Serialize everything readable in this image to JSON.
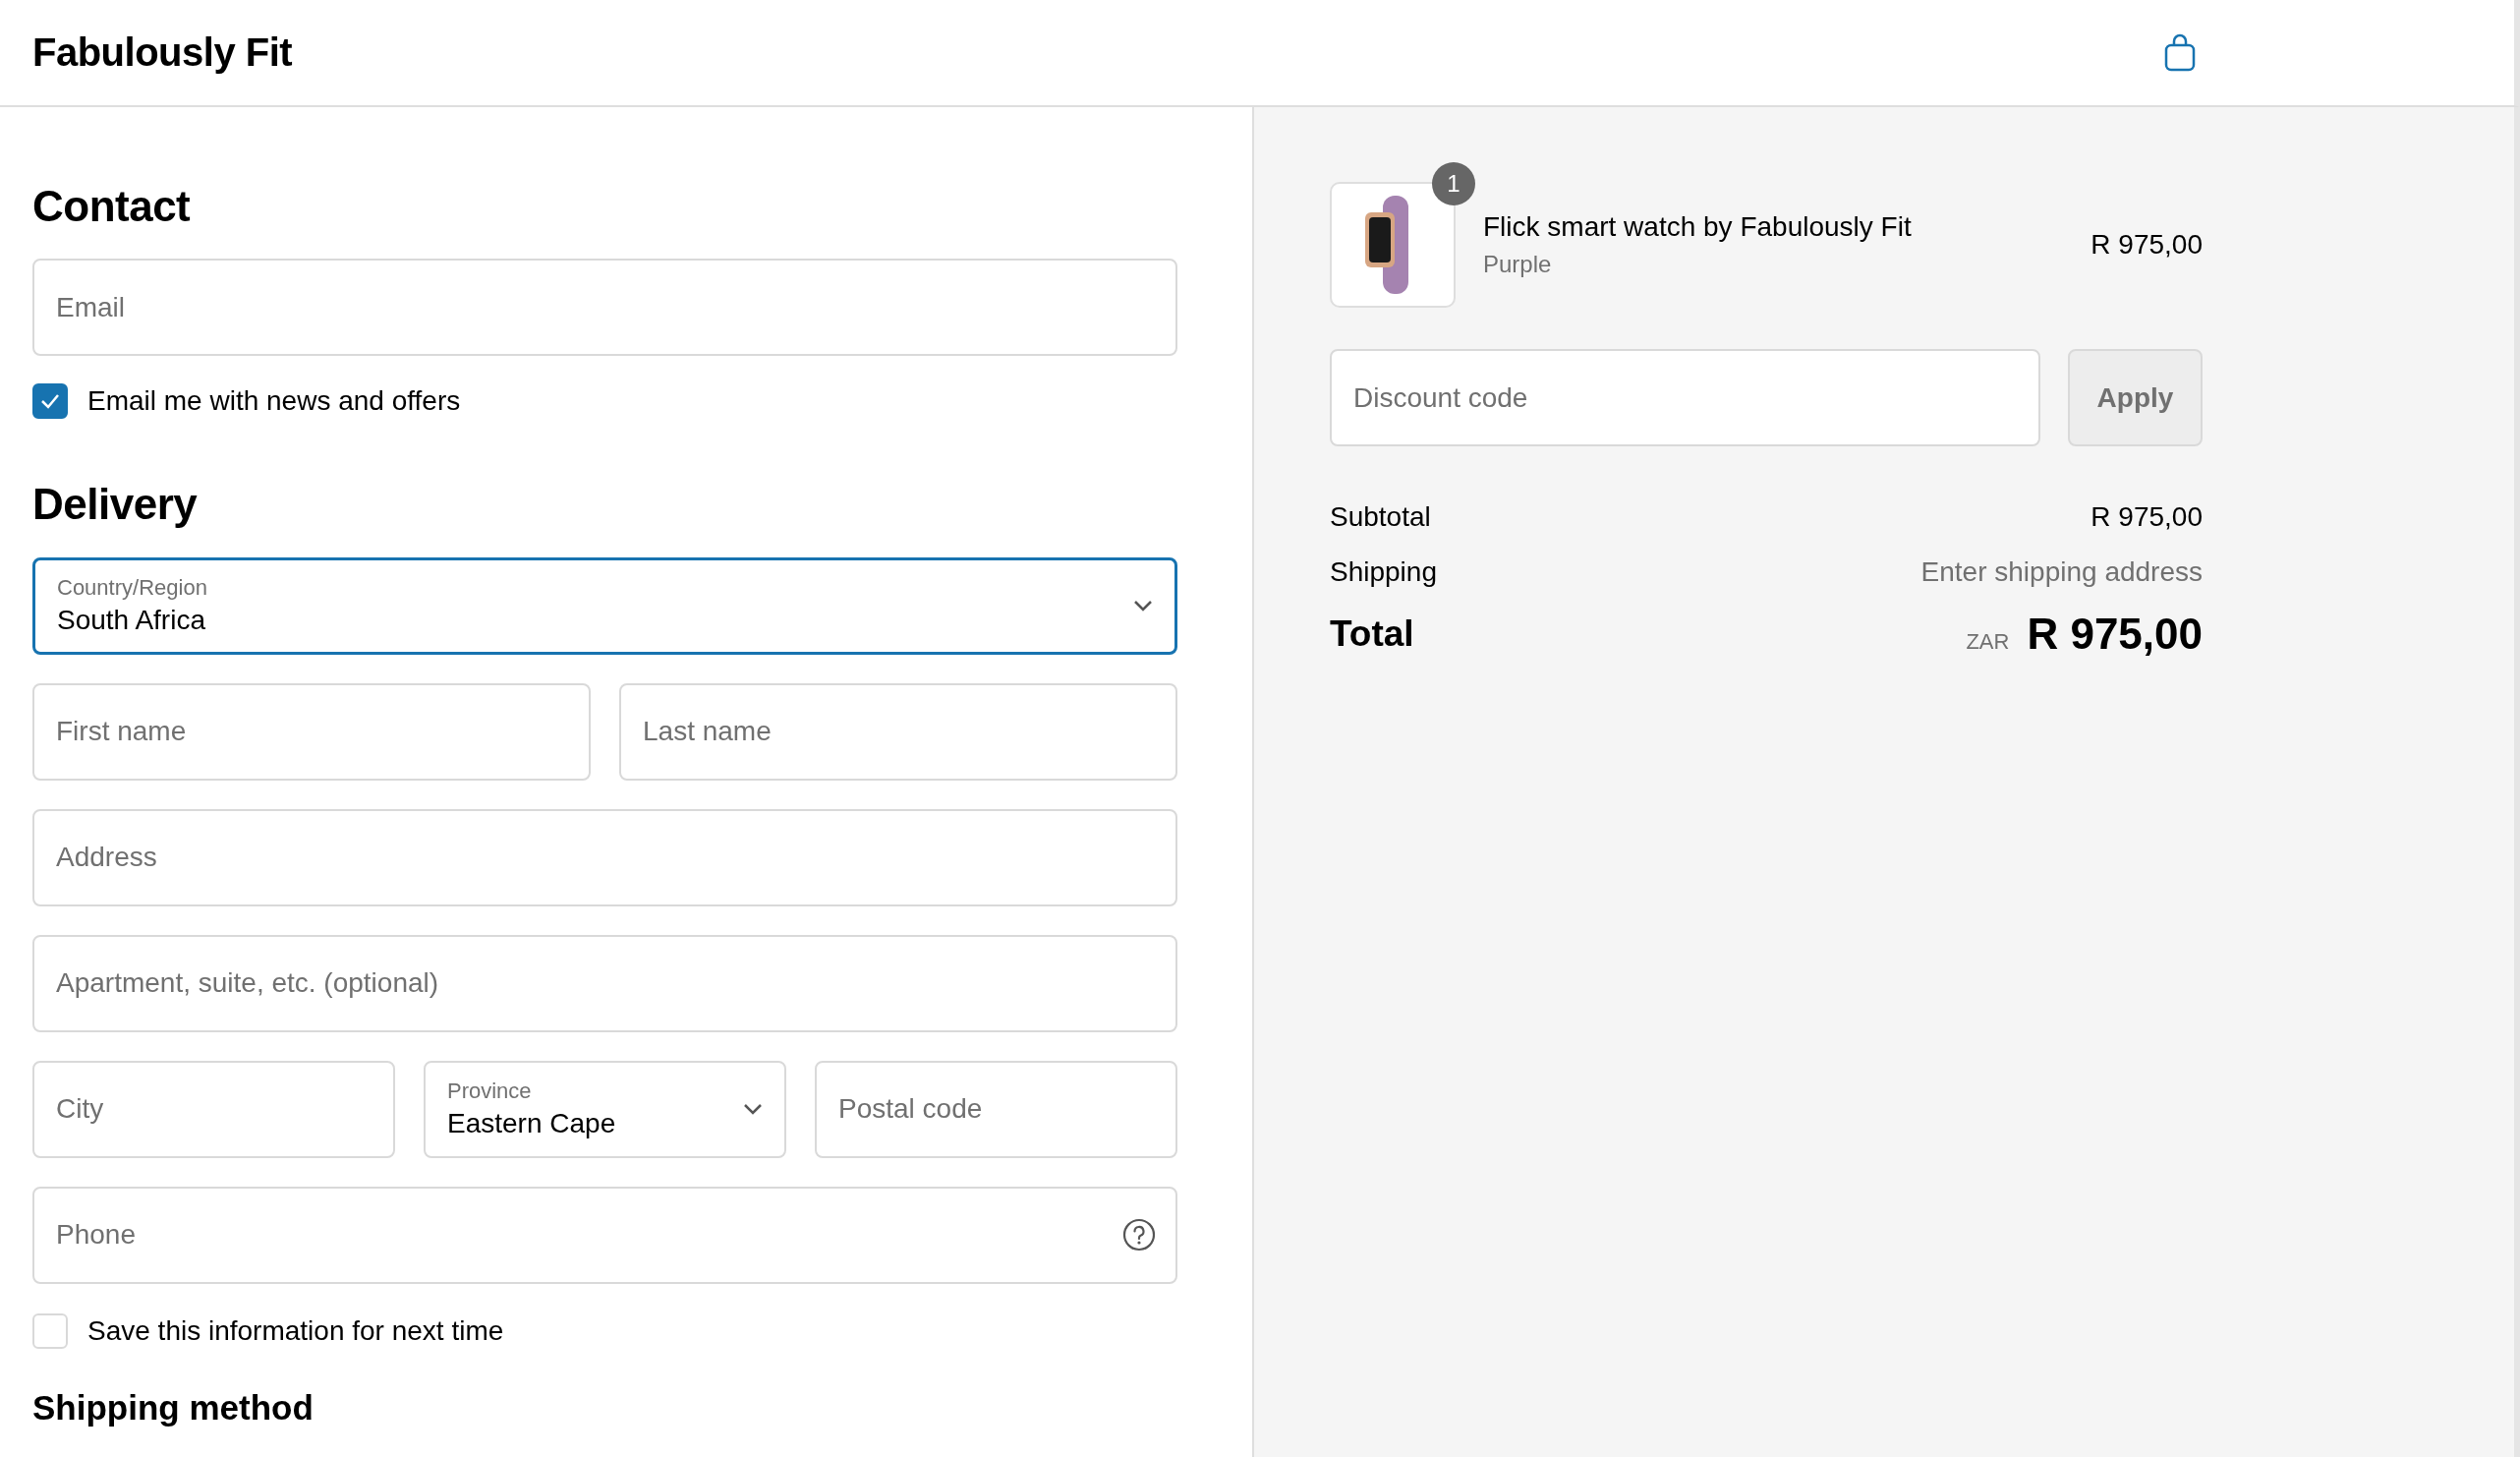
{
  "header": {
    "brand": "Fabulously Fit"
  },
  "contact": {
    "title": "Contact",
    "email": {
      "placeholder": "Email"
    },
    "newsletter": {
      "label": "Email me with news and offers",
      "checked": true
    }
  },
  "delivery": {
    "title": "Delivery",
    "rows": [
      [
        {
          "kind": "select",
          "label": "Country/Region",
          "value": "South Africa",
          "focused": true
        }
      ],
      [
        {
          "kind": "text",
          "placeholder": "First name"
        },
        {
          "kind": "text",
          "placeholder": "Last name"
        }
      ],
      [
        {
          "kind": "text",
          "placeholder": "Address"
        }
      ],
      [
        {
          "kind": "text",
          "placeholder": "Apartment, suite, etc. (optional)"
        }
      ],
      [
        {
          "kind": "text",
          "placeholder": "City"
        },
        {
          "kind": "select",
          "label": "Province",
          "value": "Eastern Cape",
          "focused": false
        },
        {
          "kind": "text",
          "placeholder": "Postal code"
        }
      ],
      [
        {
          "kind": "help",
          "placeholder": "Phone"
        }
      ]
    ],
    "save": {
      "label": "Save this information for next time",
      "checked": false
    }
  },
  "shipping_method": {
    "title": "Shipping method"
  },
  "summary": {
    "item": {
      "quantity": "1",
      "name": "Flick smart watch by Fabulously Fit",
      "variant": "Purple",
      "price": "R 975,00"
    },
    "discount": {
      "placeholder": "Discount code",
      "button": "Apply"
    },
    "lines": [
      {
        "label": "Subtotal",
        "value": "R 975,00",
        "muted": false
      },
      {
        "label": "Shipping",
        "value": "Enter shipping address",
        "muted": true
      }
    ],
    "total": {
      "label": "Total",
      "currency": "ZAR",
      "value": "R 975,00"
    }
  }
}
